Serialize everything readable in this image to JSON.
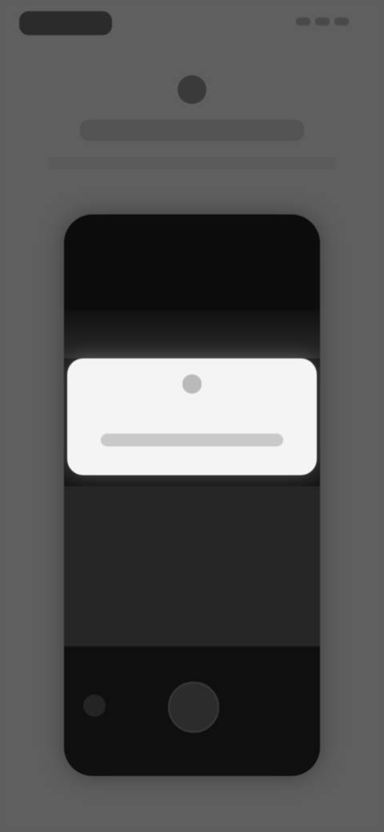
{
  "status_bar": {
    "time": "",
    "icons": [
      "signal-icon",
      "wifi-icon",
      "battery-icon"
    ]
  },
  "header": {
    "icon": "camera-icon",
    "title": "",
    "subtitle": ""
  },
  "phone_preview": {
    "dialog": {
      "icon": "info-icon",
      "text": ""
    },
    "controls": {
      "shutter_icon": "shutter-icon",
      "left_control_icon": "gallery-icon"
    }
  },
  "colors": {
    "background": "#5f5f5f",
    "phone_body": "#151515",
    "dialog_background": "#f4f4f4"
  }
}
